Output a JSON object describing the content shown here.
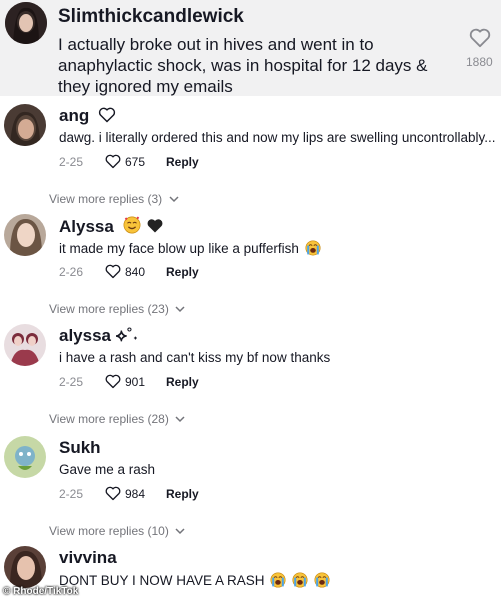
{
  "top_comment": {
    "username": "Slimthickcandlewick",
    "text": "I actually broke out in hives and went in to anaphylactic shock, was in hospital for 12 days & they ignored my emails",
    "likes": "1880"
  },
  "comments": [
    {
      "username": "ang",
      "text": "dawg. i literally ordered this and now my lips are swelling uncontrollably...",
      "date": "2-25",
      "likes": "675",
      "reply_label": "Reply",
      "view_more": "View more replies (3)"
    },
    {
      "username": "Alyssa",
      "text": "it made my face blow up like a pufferfish",
      "date": "2-26",
      "likes": "840",
      "reply_label": "Reply",
      "view_more": "View more replies (23)"
    },
    {
      "username": "alyssa ⟡˚˖",
      "text": "i have a rash and can't kiss my bf now thanks",
      "date": "2-25",
      "likes": "901",
      "reply_label": "Reply",
      "view_more": "View more replies (28)"
    },
    {
      "username": "Sukh",
      "text": "Gave me a rash",
      "date": "2-25",
      "likes": "984",
      "reply_label": "Reply",
      "view_more": "View more replies (10)"
    },
    {
      "username": "vivvina",
      "text": "DONT BUY I NOW HAVE A RASH",
      "date": "",
      "likes": "",
      "reply_label": "",
      "view_more": ""
    }
  ],
  "icons": {
    "heart": "heart-icon",
    "chevron": "chevron-down-icon",
    "crying_emoji": "loudly-crying-face-emoji",
    "smiling_hearts_emoji": "smiling-face-with-hearts-emoji",
    "black_heart": "black-heart-emoji"
  },
  "colors": {
    "top_comment_bg": "#f1f1f2",
    "muted_text": "#8a8b91",
    "text": "#161823"
  },
  "watermark": "© Rhode/TikTok"
}
